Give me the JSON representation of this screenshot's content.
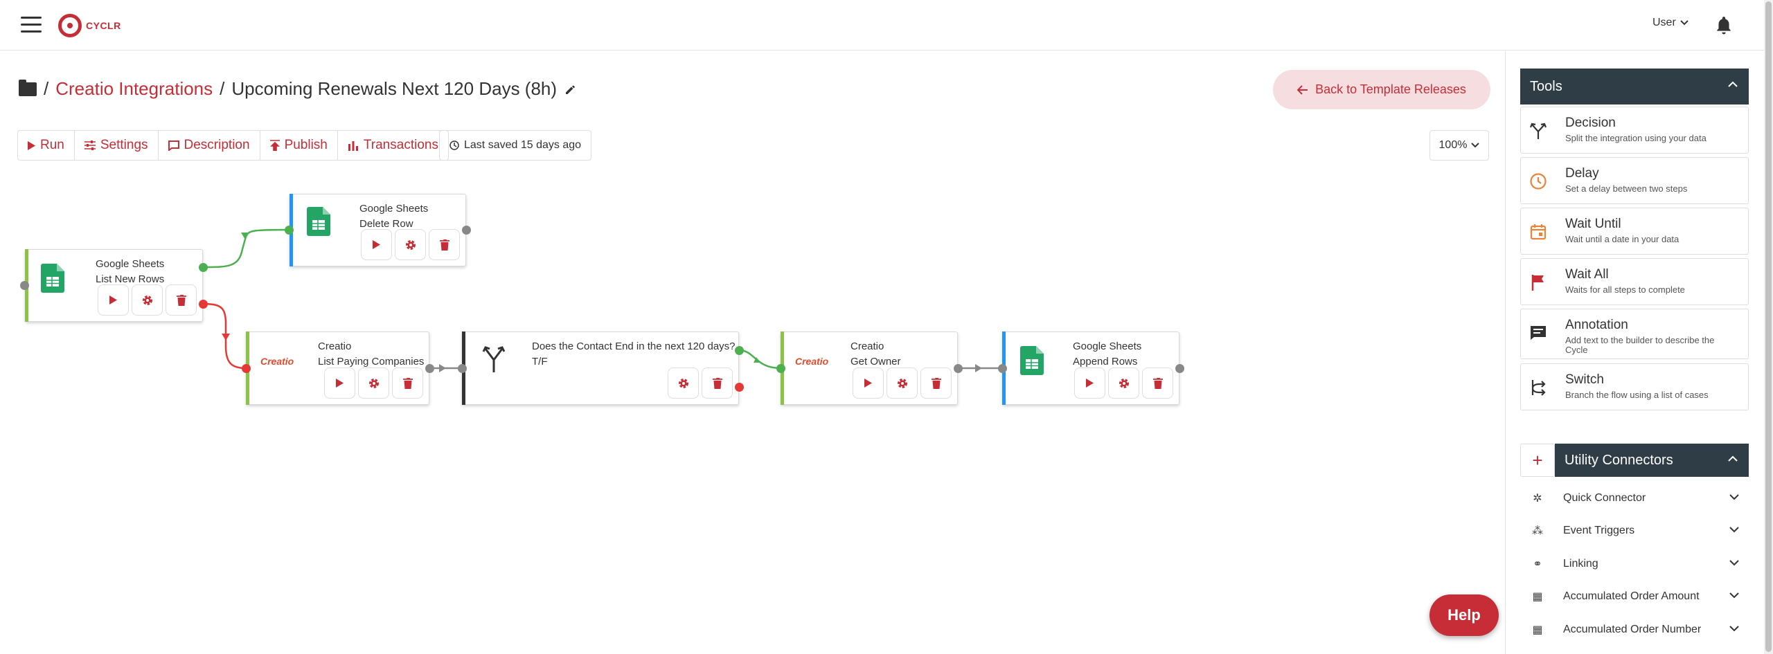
{
  "header": {
    "logo_text": "CYCLR",
    "user_label": "User"
  },
  "breadcrumb": {
    "link": "Creatio Integrations",
    "title": "Upcoming Renewals Next 120 Days (8h)",
    "sep1": "/",
    "sep2": "/"
  },
  "back_button": "Back to Template Releases",
  "toolbar": {
    "run": "Run",
    "settings": "Settings",
    "description": "Description",
    "publish": "Publish",
    "transactions": "Transactions",
    "saved": "Last saved 15 days ago",
    "zoom": "100%"
  },
  "steps": [
    {
      "title": "Google Sheets",
      "sub": "List New Rows"
    },
    {
      "title": "Google Sheets",
      "sub": "Delete Row"
    },
    {
      "title": "Creatio",
      "sub": "List Paying Companies",
      "logo": "Creatio"
    },
    {
      "title": "Does the Contact End in the next 120 days?",
      "sub": "T/F"
    },
    {
      "title": "Creatio",
      "sub": "Get Owner",
      "logo": "Creatio"
    },
    {
      "title": "Google Sheets",
      "sub": "Append Rows"
    }
  ],
  "help": "Help",
  "tools": {
    "header": "Tools",
    "items": [
      {
        "name": "Decision",
        "desc": "Split the integration using your data"
      },
      {
        "name": "Delay",
        "desc": "Set a delay between two steps"
      },
      {
        "name": "Wait Until",
        "desc": "Wait until a date in your data"
      },
      {
        "name": "Wait All",
        "desc": "Waits for all steps to complete"
      },
      {
        "name": "Annotation",
        "desc": "Add text to the builder to describe the Cycle"
      },
      {
        "name": "Switch",
        "desc": "Branch the flow using a list of cases"
      }
    ]
  },
  "utility": {
    "header": "Utility Connectors",
    "items": [
      {
        "name": "Quick Connector"
      },
      {
        "name": "Event Triggers"
      },
      {
        "name": "Linking"
      },
      {
        "name": "Accumulated Order Amount"
      },
      {
        "name": "Accumulated Order Number"
      }
    ]
  },
  "colors": {
    "accent": "#c62d36",
    "panel_header": "#2f3e46",
    "success": "#4caf50",
    "trigger_strip": "#8bc34a",
    "action_strip": "#2196f3",
    "decision_strip": "#333333"
  }
}
